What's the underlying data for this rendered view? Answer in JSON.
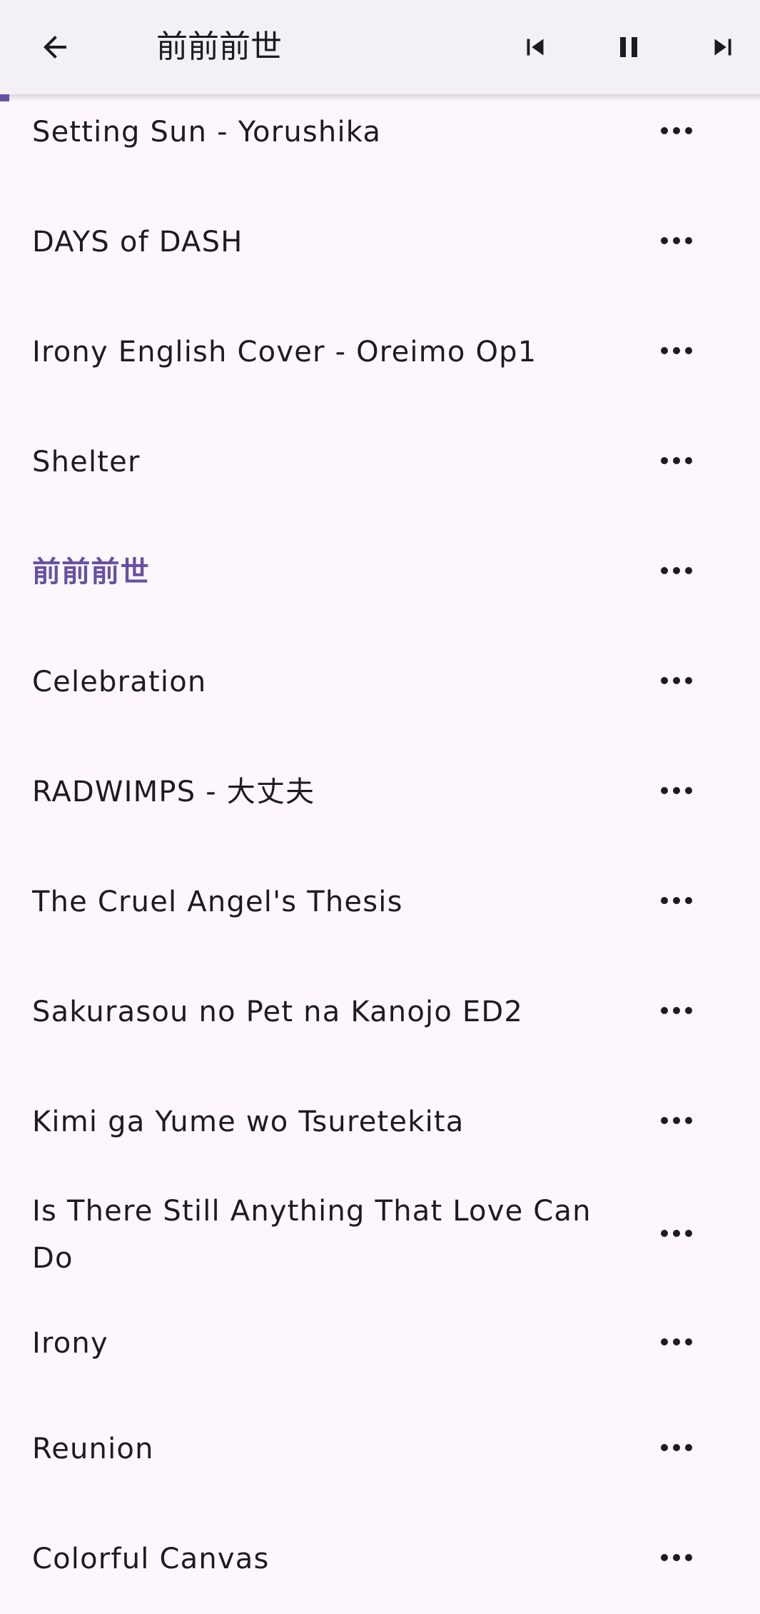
{
  "app_bar": {
    "title": "前前前世",
    "icons": {
      "back": "arrow-back-icon",
      "previous": "skip-previous-icon",
      "pause": "pause-icon",
      "next": "skip-next-icon"
    }
  },
  "playback_progress": 0.012,
  "accent_color": "#6750a4",
  "tracks": [
    {
      "title": "Setting Sun - Yorushika",
      "active": false
    },
    {
      "title": "DAYS of DASH",
      "active": false
    },
    {
      "title": "Irony English Cover - Oreimo Op1",
      "active": false
    },
    {
      "title": "Shelter",
      "active": false
    },
    {
      "title": "前前前世",
      "active": true
    },
    {
      "title": "Celebration",
      "active": false
    },
    {
      "title": "RADWIMPS - 大丈夫",
      "active": false
    },
    {
      "title": "The Cruel Angel's Thesis",
      "active": false
    },
    {
      "title": "Sakurasou no Pet na Kanojo ED2",
      "active": false
    },
    {
      "title": "Kimi ga Yume wo Tsuretekita",
      "active": false
    },
    {
      "title": "Is There Still Anything That Love Can Do",
      "active": false
    },
    {
      "title": "Irony",
      "active": false
    },
    {
      "title": "Reunion",
      "active": false
    },
    {
      "title": "Colorful Canvas",
      "active": false
    }
  ],
  "row_more_icon": "more-horizontal-icon"
}
